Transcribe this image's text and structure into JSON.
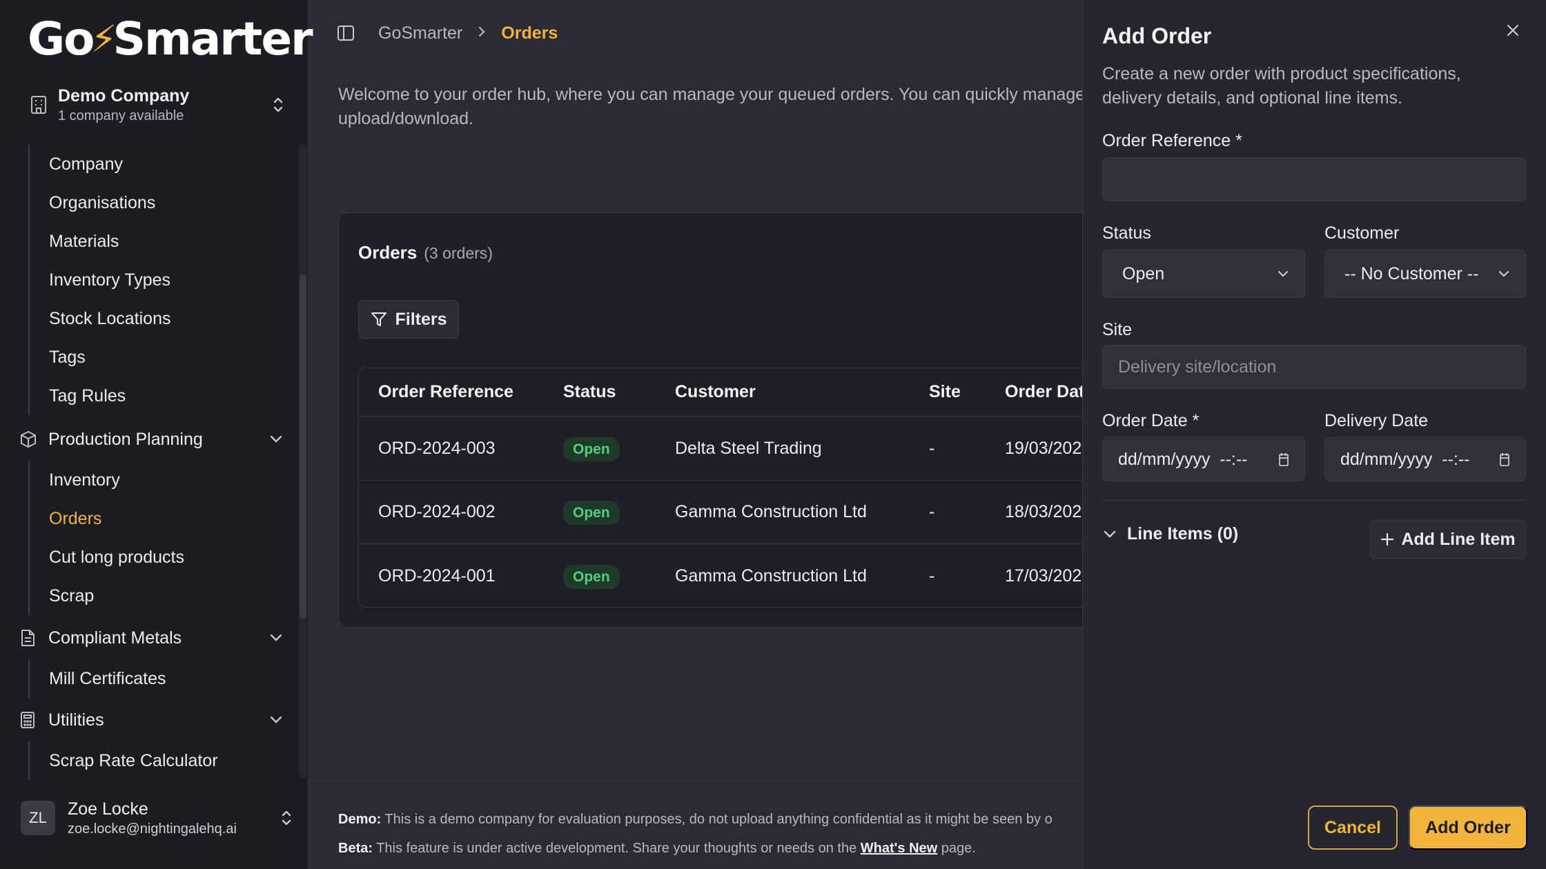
{
  "app": {
    "logo_left": "Go",
    "logo_right": "Smarter"
  },
  "company": {
    "name": "Demo Company",
    "sub": "1 company available"
  },
  "nav": {
    "group1": [
      "Company",
      "Organisations",
      "Materials",
      "Inventory Types",
      "Stock Locations",
      "Tags",
      "Tag Rules"
    ],
    "production": {
      "label": "Production Planning",
      "items": [
        "Inventory",
        "Orders",
        "Cut long products",
        "Scrap"
      ]
    },
    "compliant": {
      "label": "Compliant Metals",
      "items": [
        "Mill Certificates"
      ]
    },
    "utilities": {
      "label": "Utilities",
      "items": [
        "Scrap Rate Calculator"
      ]
    }
  },
  "user": {
    "initials": "ZL",
    "name": "Zoe Locke",
    "email": "zoe.locke@nightingalehq.ai"
  },
  "breadcrumb": {
    "root": "GoSmarter",
    "current": "Orders"
  },
  "welcome": "Welcome to your order hub, where you can manage your queued orders. You can quickly manage yo",
  "welcome2": "upload/download.",
  "orders": {
    "title": "Orders",
    "count": "(3 orders)",
    "filters_label": "Filters",
    "columns": [
      "Order Reference",
      "Status",
      "Customer",
      "Site",
      "Order Dat"
    ],
    "rows": [
      {
        "ref": "ORD-2024-003",
        "status": "Open",
        "customer": "Delta Steel Trading",
        "site": "-",
        "date": "19/03/202"
      },
      {
        "ref": "ORD-2024-002",
        "status": "Open",
        "customer": "Gamma Construction Ltd",
        "site": "-",
        "date": "18/03/202"
      },
      {
        "ref": "ORD-2024-001",
        "status": "Open",
        "customer": "Gamma Construction Ltd",
        "site": "-",
        "date": "17/03/202"
      }
    ]
  },
  "footer": {
    "demo_label": "Demo:",
    "demo_text": " This is a demo company for evaluation purposes, do not upload anything confidential as it might be seen by o",
    "beta_label": "Beta:",
    "beta_text": " This feature is under active development. Share your thoughts or needs on the ",
    "beta_link": "What's New",
    "beta_after": " page."
  },
  "drawer": {
    "title": "Add Order",
    "description": "Create a new order with product specifications, delivery details, and optional line items.",
    "order_ref_label": "Order Reference *",
    "order_ref_value": "",
    "status_label": "Status",
    "status_value": "Open",
    "customer_label": "Customer",
    "customer_value": "-- No Customer --",
    "site_label": "Site",
    "site_placeholder": "Delivery site/location",
    "order_date_label": "Order Date *",
    "order_date_placeholder": "dd/mm/yyyy  --:--",
    "delivery_date_label": "Delivery Date",
    "delivery_date_placeholder": "dd/mm/yyyy  --:--",
    "line_items_label": "Line Items (0)",
    "add_line_label": "Add Line Item",
    "cancel_label": "Cancel",
    "submit_label": "Add Order"
  },
  "colors": {
    "accent": "#f2b43a",
    "status_open": "#4fd07a",
    "background": "#2a2b33",
    "sidebar": "#1c1d23"
  }
}
